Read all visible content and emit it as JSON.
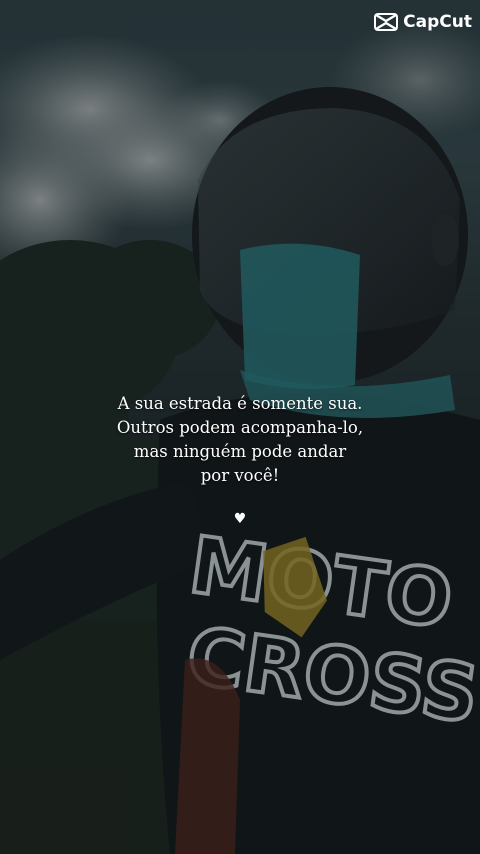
{
  "watermark": {
    "label": "CapCut",
    "icon": "capcut-logo-icon"
  },
  "quote": {
    "lines": [
      "A sua estrada é somente sua.",
      "Outros podem acompanha-lo,",
      "mas ninguém pode andar",
      "por você!"
    ]
  },
  "heart": {
    "symbol": "♥",
    "icon": "heart-icon"
  },
  "shirt": {
    "line1": "MOTO",
    "line2": "CROSS"
  },
  "colors": {
    "text": "#ffffff",
    "sky": "#3c5257",
    "mask": "#2e8a8e",
    "shirt": "#141a1c"
  }
}
